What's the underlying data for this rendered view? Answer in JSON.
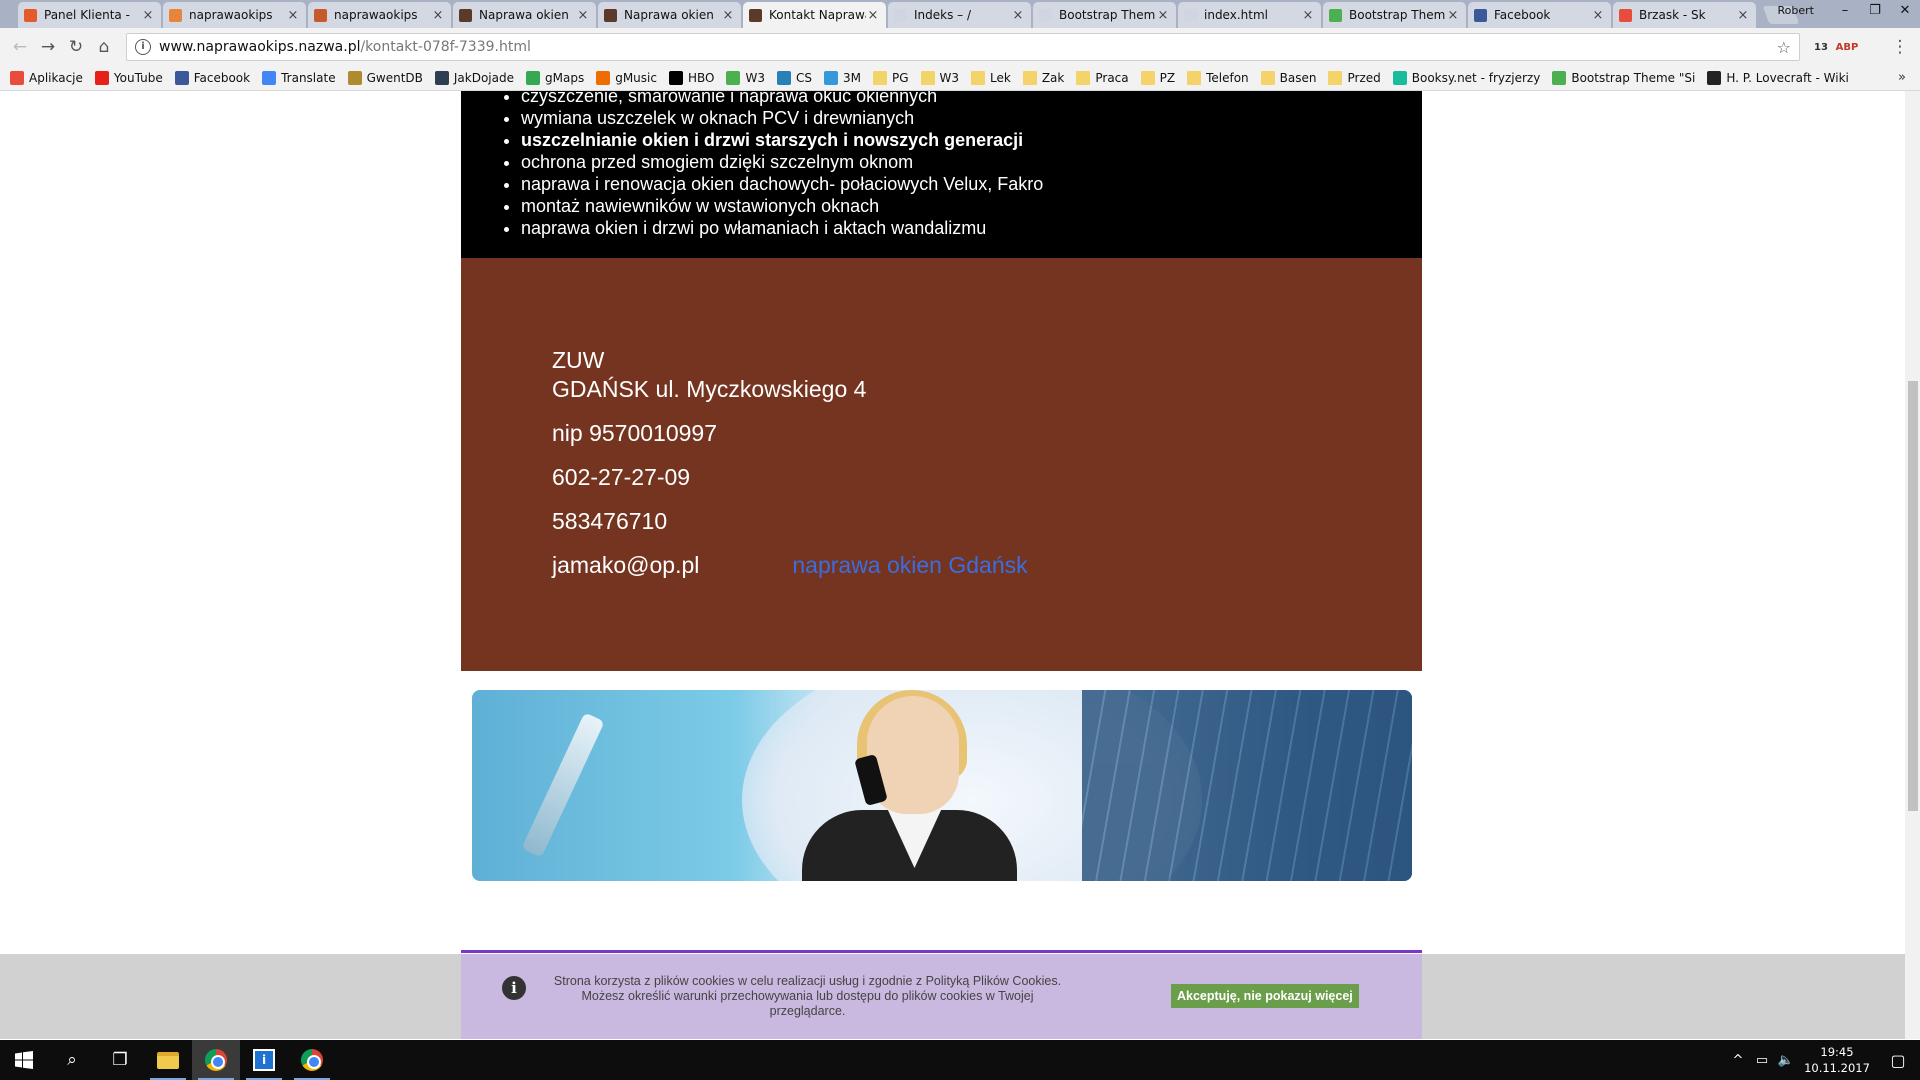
{
  "browser": {
    "tabs": [
      {
        "label": "Panel Klienta -",
        "icon_color": "#e35b2a",
        "icon": "hostinger-icon"
      },
      {
        "label": "naprawaokips",
        "icon_color": "#e8843b",
        "icon": "site-icon"
      },
      {
        "label": "naprawaokips",
        "icon_color": "#c75a2b",
        "icon": "site-icon"
      },
      {
        "label": "Naprawa okien",
        "icon_color": "#5b3a2a",
        "icon": "site-icon"
      },
      {
        "label": "Naprawa okien",
        "icon_color": "#5b3a2a",
        "icon": "site-icon"
      },
      {
        "label": "Kontakt Naprawa",
        "icon_color": "#5b3a2a",
        "icon": "site-icon"
      },
      {
        "label": "Indeks – /",
        "icon_color": "#cfd6e2",
        "icon": "page-icon"
      },
      {
        "label": "Bootstrap Them",
        "icon_color": "#cfd6e2",
        "icon": "page-icon"
      },
      {
        "label": "index.html",
        "icon_color": "#cfd6e2",
        "icon": "page-icon"
      },
      {
        "label": "Bootstrap Them",
        "icon_color": "#4caf50",
        "icon": "w3-icon"
      },
      {
        "label": "Facebook",
        "icon_color": "#3b5998",
        "icon": "facebook-icon"
      },
      {
        "label": "Brzask - Sk",
        "icon_color": "#e74c3c",
        "icon": "music-icon"
      }
    ],
    "active_tab_index": 5,
    "user": "Robert",
    "url_host": "www.naprawaokips.nazwa.pl",
    "url_path": "/kontakt-078f-7339.html",
    "extensions": [
      {
        "name": "extension-icon",
        "badge": "13",
        "color": "#333"
      },
      {
        "name": "adblock-icon",
        "badge": "ABP",
        "color": "#c0392b"
      },
      {
        "name": "eyedropper-icon",
        "badge": "",
        "color": "#555"
      }
    ],
    "bookmarks": [
      {
        "label": "Aplikacje",
        "icon": "apps-icon",
        "color": "#e74c3c"
      },
      {
        "label": "YouTube",
        "icon": "youtube-icon",
        "color": "#e62117"
      },
      {
        "label": "Facebook",
        "icon": "facebook-icon",
        "color": "#3b5998"
      },
      {
        "label": "Translate",
        "icon": "translate-icon",
        "color": "#4285f4"
      },
      {
        "label": "GwentDB",
        "icon": "gwent-icon",
        "color": "#b08a2e"
      },
      {
        "label": "JakDojade",
        "icon": "check-icon",
        "color": "#2c3e50"
      },
      {
        "label": "gMaps",
        "icon": "maps-icon",
        "color": "#34a853"
      },
      {
        "label": "gMusic",
        "icon": "music-icon",
        "color": "#ef6c00"
      },
      {
        "label": "HBO",
        "icon": "hbo-icon",
        "color": "#000"
      },
      {
        "label": "W3",
        "icon": "w3-icon",
        "color": "#4caf50"
      },
      {
        "label": "CS",
        "icon": "cs-icon",
        "color": "#2980b9"
      },
      {
        "label": "3M",
        "icon": "mail-icon",
        "color": "#3498db"
      },
      {
        "label": "PG",
        "icon": "folder-icon",
        "color": "folder"
      },
      {
        "label": "W3",
        "icon": "folder-icon",
        "color": "folder"
      },
      {
        "label": "Lek",
        "icon": "folder-icon",
        "color": "folder"
      },
      {
        "label": "Zak",
        "icon": "folder-icon",
        "color": "folder"
      },
      {
        "label": "Praca",
        "icon": "folder-icon",
        "color": "folder"
      },
      {
        "label": "PZ",
        "icon": "folder-icon",
        "color": "folder"
      },
      {
        "label": "Telefon",
        "icon": "folder-icon",
        "color": "folder"
      },
      {
        "label": "Basen",
        "icon": "folder-icon",
        "color": "folder"
      },
      {
        "label": "Przed",
        "icon": "folder-icon",
        "color": "folder"
      },
      {
        "label": "Booksy.net - fryzjerzy",
        "icon": "booksy-icon",
        "color": "#1abc9c"
      },
      {
        "label": "Bootstrap Theme \"Si",
        "icon": "w3-icon",
        "color": "#4caf50"
      },
      {
        "label": "H. P. Lovecraft - Wiki",
        "icon": "wikipedia-icon",
        "color": "#222"
      }
    ],
    "bookmarks_more": "»"
  },
  "page": {
    "services": [
      {
        "text": "czyszczenie, smarowanie i naprawa okuć okiennych",
        "bold": false
      },
      {
        "text": "wymiana uszczelek w oknach PCV i drewnianych",
        "bold": false
      },
      {
        "text": "uszczelnianie okien i drzwi starszych i nowszych generacji",
        "bold": true
      },
      {
        "text": "ochrona przed smogiem dzięki szczelnym oknom",
        "bold": false
      },
      {
        "text": "naprawa i renowacja okien dachowych- połaciowych Velux, Fakro",
        "bold": false
      },
      {
        "text": "montaż nawiewników w wstawionych oknach",
        "bold": false
      },
      {
        "text": "naprawa okien i drzwi po włamaniach i aktach wandalizmu",
        "bold": false
      }
    ],
    "contact": {
      "company": "ZUW",
      "address": "GDAŃSK ul. Myczkowskiego 4",
      "nip": "nip 9570010997",
      "phone1": "602-27-27-09",
      "phone2": "583476710",
      "email": "jamako@op.pl",
      "link": "naprawa okien Gdańsk"
    },
    "colors": {
      "black_section": "#000000",
      "brown_section": "#753420",
      "link": "#3a6ee0",
      "divider": "#7a37c7"
    }
  },
  "cookie": {
    "text": "Strona korzysta z plików cookies w celu realizacji usług i zgodnie z Polityką Plików Cookies. Możesz określić warunki przechowywania lub dostępu do plików cookies w Twojej przeglądarce.",
    "button": "Akceptuję, nie pokazuj więcej",
    "button_color": "#6b9e4a"
  },
  "taskbar": {
    "time": "19:45",
    "date": "10.11.2017",
    "apps": [
      "start-icon",
      "search-icon",
      "task-view-icon",
      "file-explorer-icon",
      "chrome-icon",
      "store-icon",
      "chrome-icon"
    ]
  }
}
